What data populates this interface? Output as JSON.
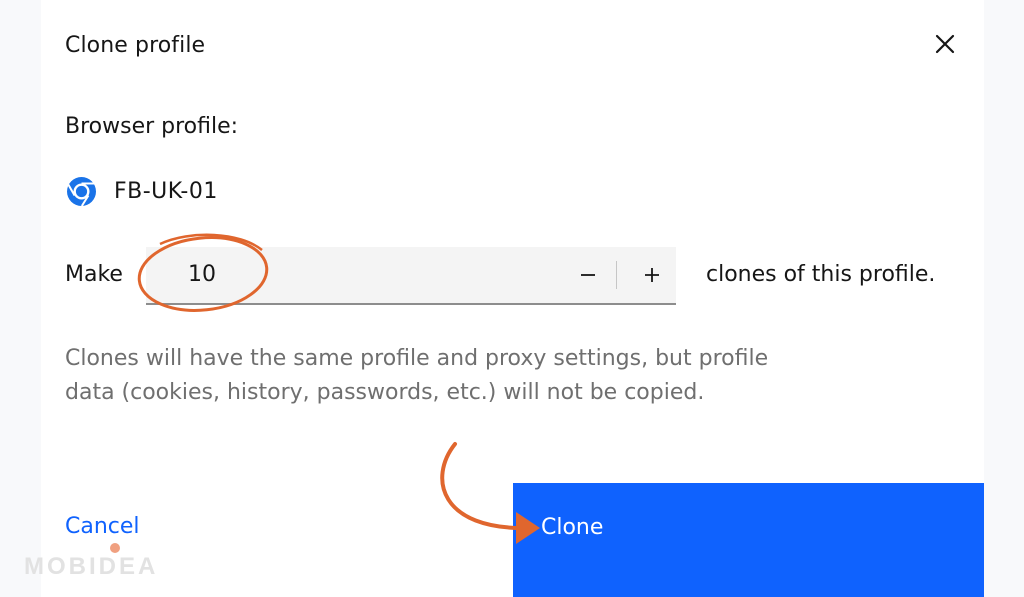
{
  "dialog": {
    "title": "Clone profile",
    "close_icon": "close-icon",
    "browser_profile_label": "Browser profile:",
    "profile": {
      "icon": "chrome-icon",
      "name": "FB-UK-01"
    },
    "make_label": "Make",
    "clone_count": "10",
    "decrement_symbol": "−",
    "increment_symbol": "+",
    "suffix_label": "clones of this profile.",
    "helper_text": "Clones will have the same profile and proxy settings, but profile data (cookies, history, passwords, etc.) will not be copied.",
    "cancel_label": "Cancel",
    "clone_label": "Clone"
  },
  "watermark": "MOBIDEA",
  "colors": {
    "primary": "#0f62fe",
    "annotation": "#e0662e",
    "text": "#161616",
    "helper_text": "#6f6f6f",
    "field_background": "#f4f4f4"
  }
}
